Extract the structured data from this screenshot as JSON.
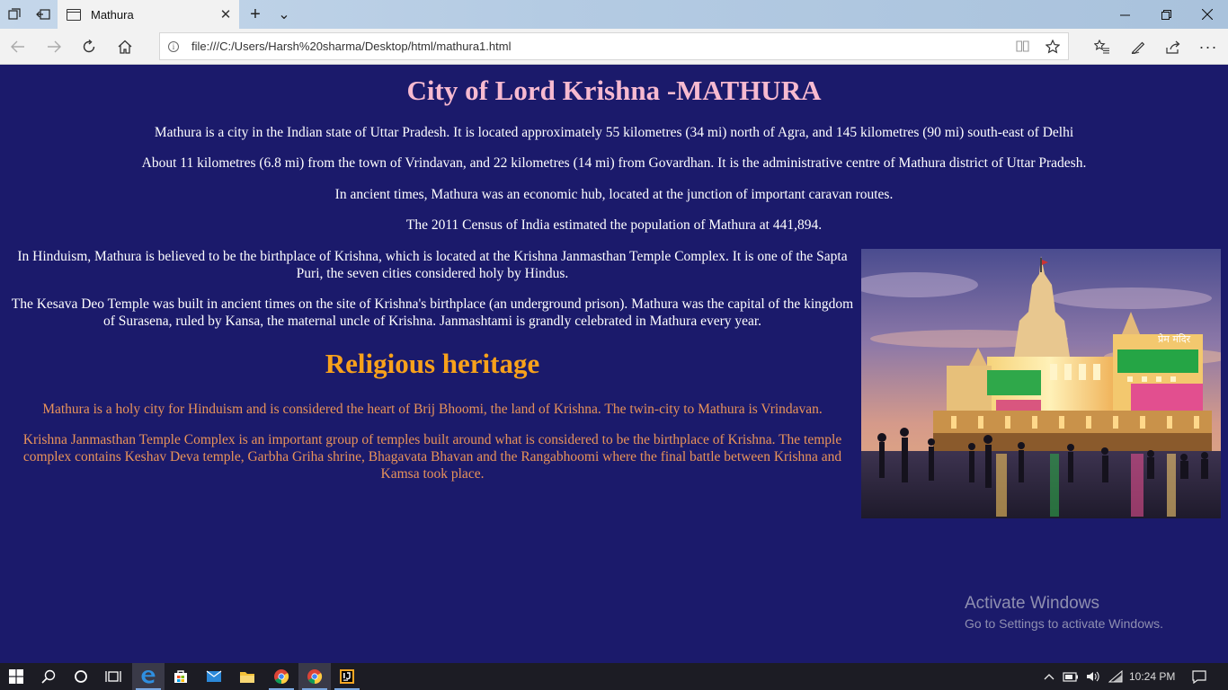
{
  "browser": {
    "tab_title": "Mathura",
    "tab_close": "✕",
    "new_tab": "+",
    "tab_menu": "⌄",
    "address": "file:///C:/Users/Harsh%20sharma/Desktop/html/mathura1.html",
    "address_info": "i"
  },
  "page": {
    "title": "City of Lord Krishna -MATHURA",
    "intro": [
      "Mathura is a city in the Indian state of Uttar Pradesh. It is located approximately 55 kilometres (34 mi) north of Agra, and 145 kilometres (90 mi) south-east of Delhi",
      "About 11 kilometres (6.8 mi) from the town of Vrindavan, and 22 kilometres (14 mi) from Govardhan. It is the administrative centre of Mathura district of Uttar Pradesh.",
      "In ancient times, Mathura was an economic hub, located at the junction of important caravan routes.",
      "The 2011 Census of India estimated the population of Mathura at 441,894."
    ],
    "hinduism": "In Hinduism, Mathura is believed to be the birthplace of Krishna, which is located at the Krishna Janmasthan Temple Complex. It is one of the Sapta Puri, the seven cities considered holy by Hindus.",
    "kesava": "The Kesava Deo Temple was built in ancient times on the site of Krishna's birthplace (an underground prison). Mathura was the capital of the kingdom of Surasena, ruled by Kansa, the maternal uncle of Krishna. Janmashtami is grandly celebrated in Mathura every year.",
    "heritage_heading": "Religious heritage",
    "heritage": [
      "Mathura is a holy city for Hinduism and is considered the heart of Brij Bhoomi, the land of Krishna. The twin-city to Mathura is Vrindavan.",
      "Krishna Janmasthan Temple Complex is an important group of temples built around what is considered to be the birthplace of Krishna. The temple complex contains Keshav Deva temple, Garbha Griha shrine, Bhagavata Bhavan and the Rangabhoomi where the final battle between Krishna and Kamsa took place."
    ],
    "temple_sign": "प्रेम मंदिर"
  },
  "watermark": {
    "line1": "Activate Windows",
    "line2": "Go to Settings to activate Windows."
  },
  "taskbar": {
    "clock": "10:24 PM"
  },
  "colors": {
    "page_bg": "#1b1a6b",
    "title": "#f7bad0",
    "heading_orange": "#f8a11b",
    "text_orange": "#e9935a"
  }
}
